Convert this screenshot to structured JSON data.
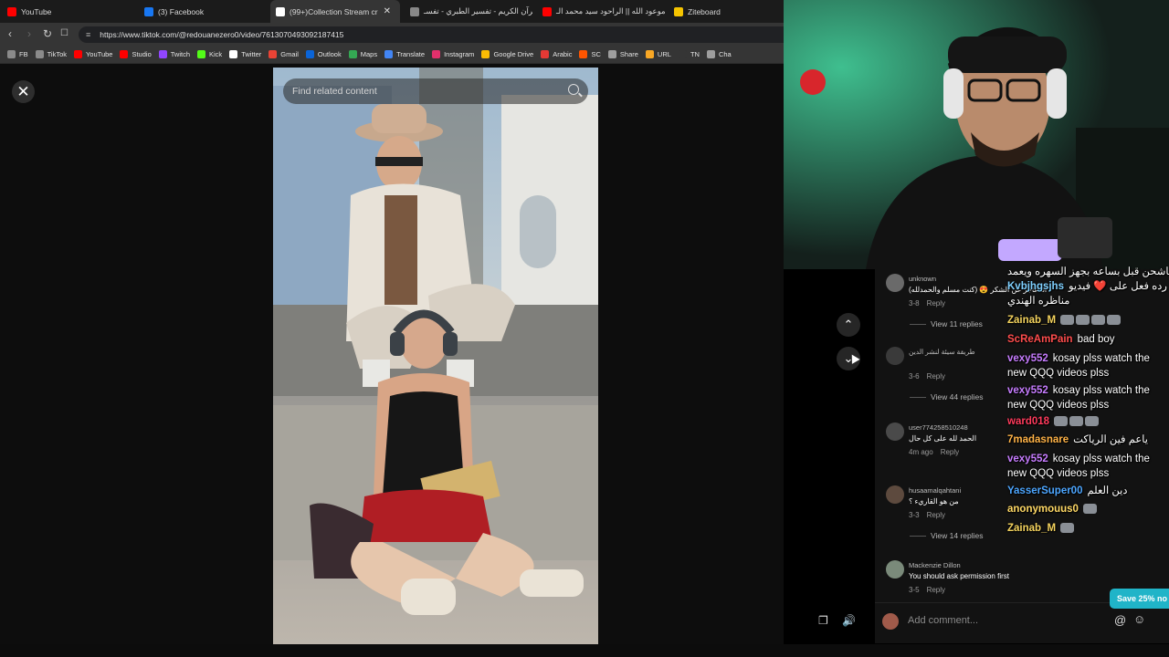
{
  "browser": {
    "tabs": [
      {
        "label": "YouTube",
        "color": "#ff0000"
      },
      {
        "label": "(3) Facebook",
        "color": "#1877f2"
      },
      {
        "label": "(99+)Collection Stream cr",
        "color": "#ffffff",
        "active": true
      },
      {
        "label": "القرآن الكريم - تفسير الطبري - تفسـ",
        "color": "#888888"
      },
      {
        "label": "موعود الله || الراحود سيد محمد الـ ||",
        "color": "#ff0000"
      },
      {
        "label": "Ziteboard",
        "color": "#f5c400"
      }
    ],
    "close_tab_glyph": "✕",
    "url": "https://www.tiktok.com/@redouanezero0/video/7613070493092187415",
    "bookmarks": [
      {
        "label": "FB",
        "color": "#8a8a8a"
      },
      {
        "label": "TikTok",
        "color": "#8a8a8a"
      },
      {
        "label": "YouTube",
        "color": "#ff0000"
      },
      {
        "label": "Studio",
        "color": "#ff0000"
      },
      {
        "label": "Twitch",
        "color": "#9146ff"
      },
      {
        "label": "Kick",
        "color": "#53fc18"
      },
      {
        "label": "Twitter",
        "color": "#ffffff"
      },
      {
        "label": "Gmail",
        "color": "#ea4335"
      },
      {
        "label": "Outlook",
        "color": "#0a64d8"
      },
      {
        "label": "Maps",
        "color": "#34a853"
      },
      {
        "label": "Translate",
        "color": "#4285f4"
      },
      {
        "label": "Instagram",
        "color": "#e1306c"
      },
      {
        "label": "Google Drive",
        "color": "#fbbc04"
      },
      {
        "label": "Arabic",
        "color": "#e53935"
      },
      {
        "label": "SC",
        "color": "#ff5500"
      },
      {
        "label": "Share",
        "color": "#9e9e9e"
      },
      {
        "label": "URL",
        "color": "#f9a825"
      },
      {
        "label": "TN",
        "color": "#353535"
      },
      {
        "label": "Cha",
        "color": "#9e9e9e"
      }
    ]
  },
  "tiktok": {
    "close_glyph": "✕",
    "search_placeholder": "Find related content",
    "up_glyph": "⌃",
    "down_glyph": "⌄",
    "comments": [
      {
        "user": "unknown",
        "text": "أنا عاجز عن الشكر 😍 (كنت مسلم والحمدلله)",
        "meta": "3-8",
        "reply": "Reply",
        "view_replies": "View 11 replies",
        "avatar_color": "#6a6a6a"
      },
      {
        "user": "طريقة سيئة لنشر الدين",
        "text": "",
        "meta": "3-6",
        "reply": "Reply",
        "view_replies": "View 44 replies",
        "avatar_color": "#3a3a3a"
      },
      {
        "user": "user774258510248",
        "text": "الحمد لله على كل حال",
        "meta": "4m ago",
        "reply": "Reply",
        "view_replies": "",
        "avatar_color": "#4a4a4a"
      },
      {
        "user": "husaamalqahtani",
        "text": "من هو القاريء ؟",
        "meta": "3-3",
        "reply": "Reply",
        "view_replies": "View 14 replies",
        "avatar_color": "#5d4a3e"
      },
      {
        "user": "Mackenzie Dillon",
        "text": "You should ask permission first",
        "meta": "3-5",
        "reply": "Reply",
        "view_replies": "",
        "avatar_color": "#7a8a7a"
      }
    ],
    "add_comment_placeholder": "Add comment...",
    "save_badge": "Save 25% no"
  },
  "chat": [
    {
      "user": "",
      "user_color": "#ffffff",
      "text": "عاشحن قبل بساعه بجهز السهره ويعمد 😭"
    },
    {
      "user": "Kvbjhgsjhs",
      "user_color": "#7fd0ff",
      "text": "قصي رده فعل على ❤️ فيديو"
    },
    {
      "user": "",
      "user_color": "#ffffff",
      "text": "مناظره الهندي"
    },
    {
      "user": "Zainab_M",
      "user_color": "#f4d35e",
      "text": "",
      "emotes": 4
    },
    {
      "user": "ScReAmPain",
      "user_color": "#ff4d4d",
      "text": "bad boy"
    },
    {
      "user": "vexy552",
      "user_color": "#c77dff",
      "text": "kosay plss watch the"
    },
    {
      "user": "",
      "user_color": "#ffffff",
      "text": "new QQQ videos plss"
    },
    {
      "user": "vexy552",
      "user_color": "#c77dff",
      "text": "kosay plss watch the"
    },
    {
      "user": "",
      "user_color": "#ffffff",
      "text": "new QQQ videos plss"
    },
    {
      "user": "ward018",
      "user_color": "#ff3b5c",
      "text": "",
      "emotes": 3
    },
    {
      "user": "7madasnare",
      "user_color": "#ffb347",
      "text": "ياعم فين الرياكت"
    },
    {
      "user": "vexy552",
      "user_color": "#c77dff",
      "text": "kosay plss watch the"
    },
    {
      "user": "",
      "user_color": "#ffffff",
      "text": "new QQQ videos plss"
    },
    {
      "user": "YasserSuper00",
      "user_color": "#4da6ff",
      "text": "دين العلم"
    },
    {
      "user": "anonymouus0",
      "user_color": "#ffd966",
      "text": "",
      "emotes": 1
    },
    {
      "user": "Zainab_M",
      "user_color": "#f4d35e",
      "text": "",
      "emotes": 1
    }
  ]
}
